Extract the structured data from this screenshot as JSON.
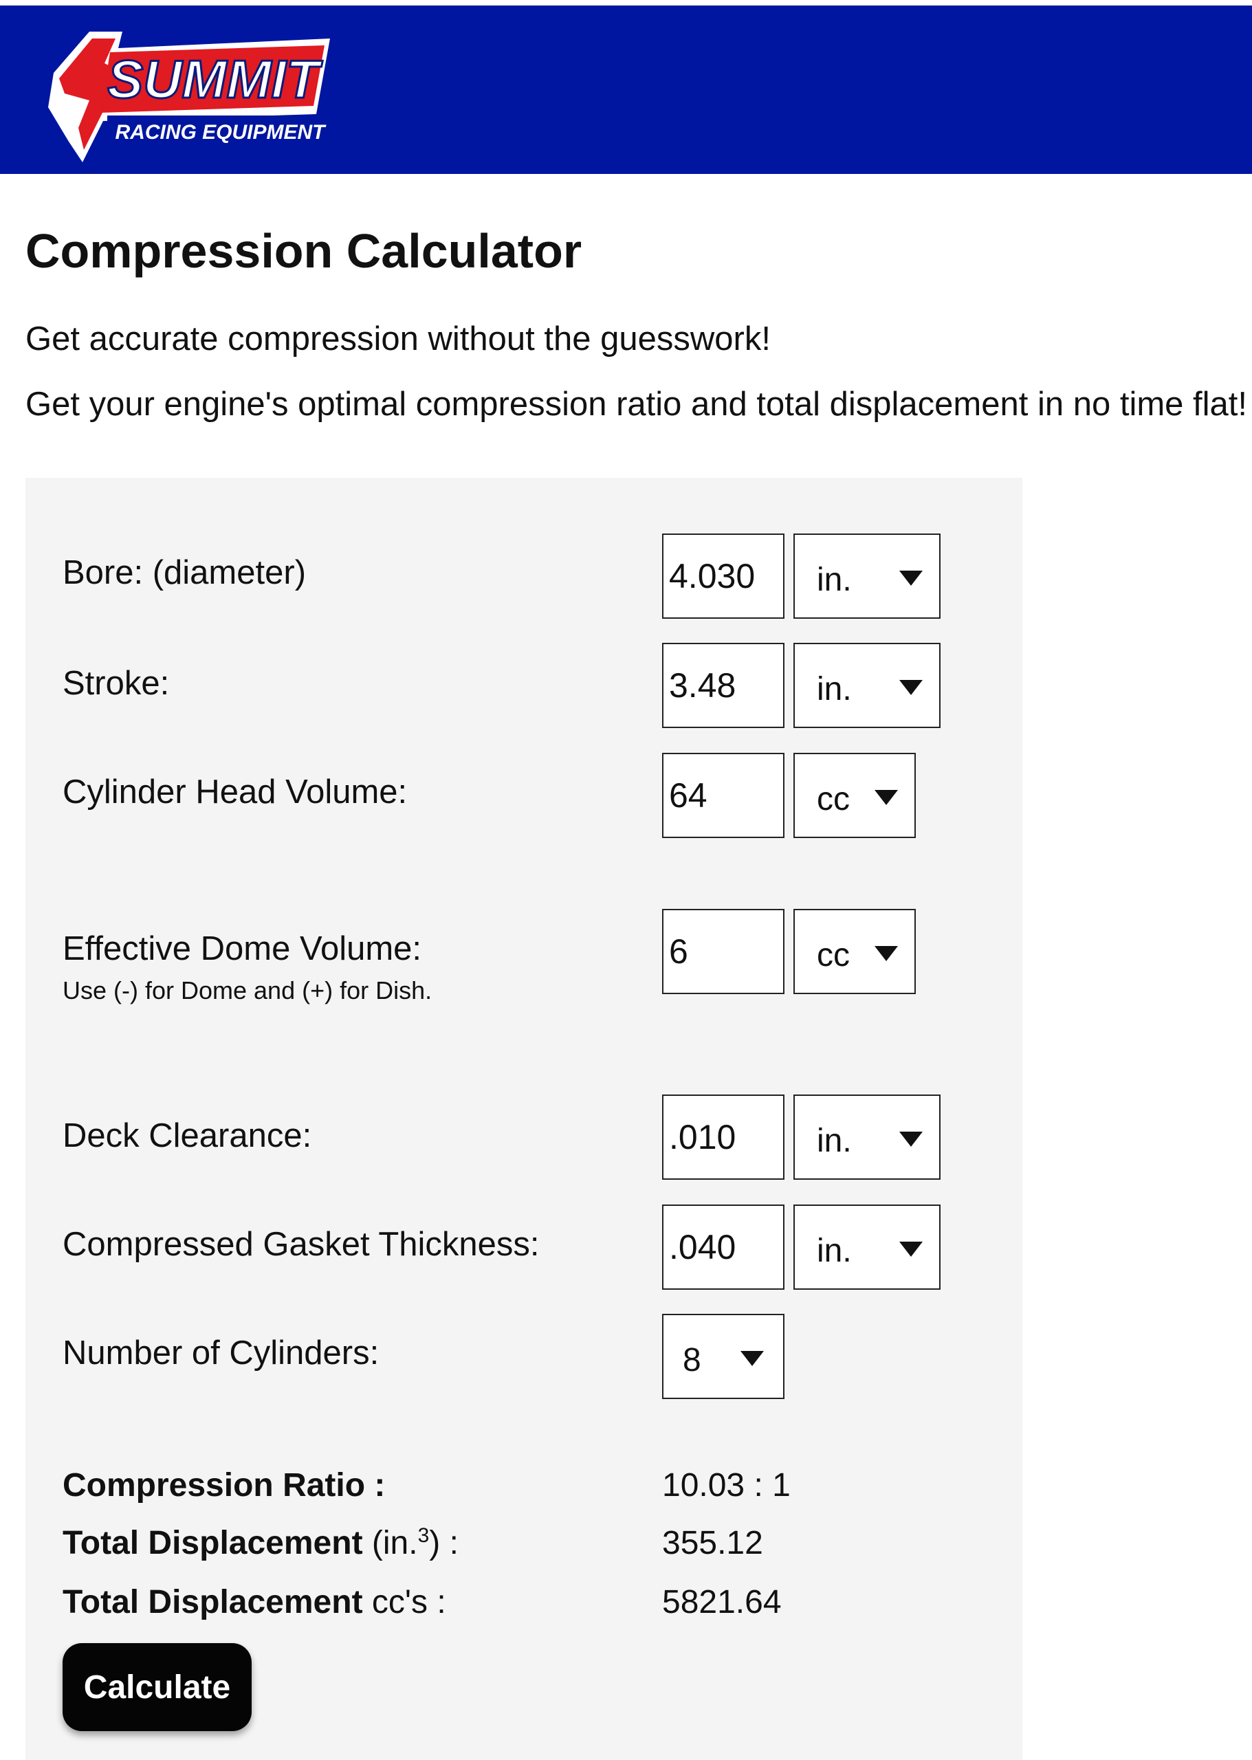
{
  "header": {
    "logo_text": "SUMMIT",
    "logo_subtext": "RACING EQUIPMENT",
    "brand_color": "#0016a0",
    "logo_red": "#e01b22"
  },
  "page": {
    "title": "Compression Calculator",
    "intro_line1": "Get accurate compression without the guesswork!",
    "intro_line2": "Get your engine's optimal compression ratio and total displacement in no time flat! ."
  },
  "form": {
    "bore": {
      "label": "Bore: (diameter)",
      "value": "4.030",
      "unit": "in."
    },
    "stroke": {
      "label": "Stroke:",
      "value": "3.48",
      "unit": "in."
    },
    "head_volume": {
      "label": "Cylinder Head Volume:",
      "value": "64",
      "unit": "cc"
    },
    "dome_volume": {
      "label": "Effective Dome Volume:",
      "hint": "Use (-) for Dome and (+) for Dish.",
      "value": "6",
      "unit": "cc"
    },
    "deck_clearance": {
      "label": "Deck Clearance:",
      "value": ".010",
      "unit": "in."
    },
    "gasket_thickness": {
      "label": "Compressed Gasket Thickness:",
      "value": ".040",
      "unit": "in."
    },
    "cylinders": {
      "label": "Number of Cylinders:",
      "value": "8"
    }
  },
  "results": {
    "compression_ratio": {
      "label": "Compression Ratio :",
      "value": "10.03 : 1"
    },
    "displacement_in": {
      "label_bold": "Total Displacement",
      "label_rest_prefix": " (in.",
      "label_sup": "3",
      "label_rest_suffix": ") :",
      "value": "355.12"
    },
    "displacement_cc": {
      "label_bold": "Total Displacement",
      "label_rest": " cc's :",
      "value": "5821.64"
    }
  },
  "actions": {
    "calculate_label": "Calculate"
  },
  "icons": {
    "dropdown": "caret-down-icon"
  }
}
